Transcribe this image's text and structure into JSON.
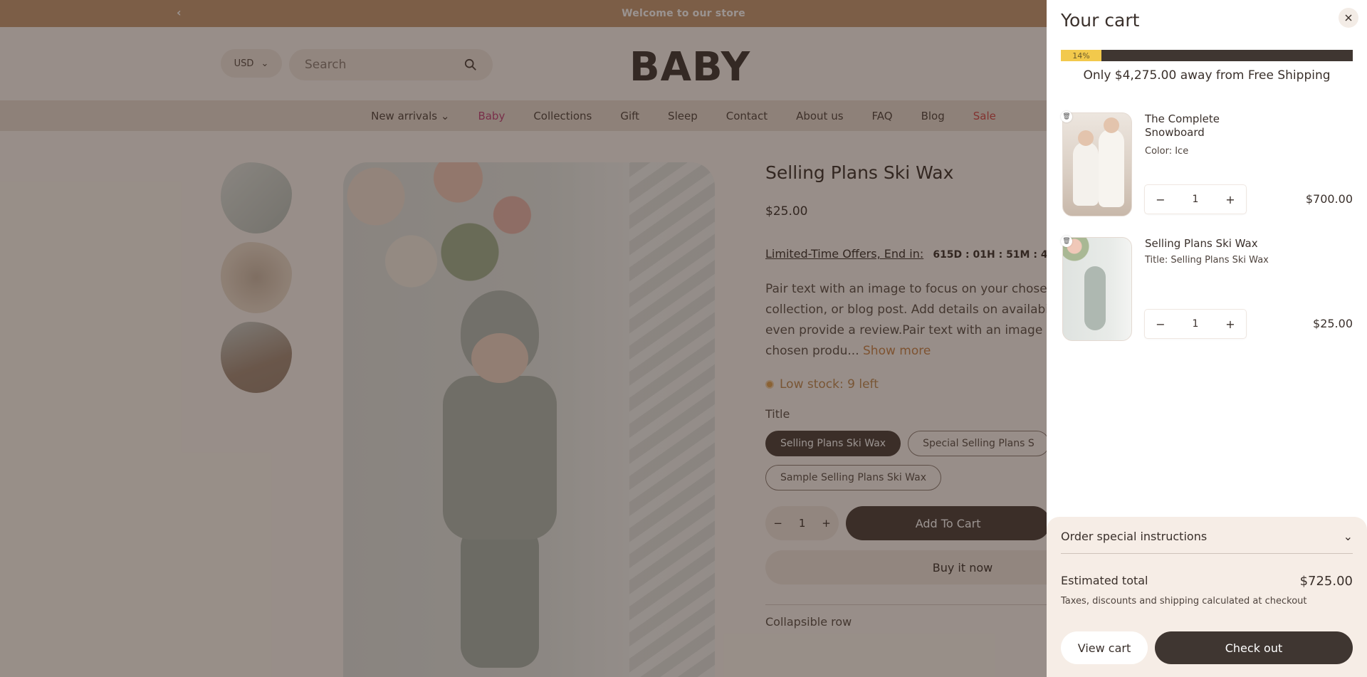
{
  "announcement": {
    "text": "Welcome to our store",
    "prev_icon": "chevron-left-icon"
  },
  "header": {
    "currency": "USD",
    "search_placeholder": "Search",
    "logo": "BABY"
  },
  "nav": {
    "items": [
      "New arrivals",
      "Baby",
      "Collections",
      "Gift",
      "Sleep",
      "Contact",
      "About us",
      "FAQ",
      "Blog",
      "Sale"
    ]
  },
  "product": {
    "title": "Selling Plans Ski Wax",
    "price": "$25.00",
    "offer_label": "Limited-Time Offers, End in:",
    "countdown": "615D : 01H : 51M : 4",
    "description_lines": [
      "Pair text with an image to focus on your chosen",
      "collection, or blog post. Add details on availabi",
      "even provide a review.Pair text with an image t",
      "chosen produ..."
    ],
    "show_more": "Show more",
    "stock": "Low stock: 9 left",
    "option_label": "Title",
    "options": [
      "Selling Plans Ski Wax",
      "Special Selling Plans S",
      "Sample Selling Plans Ski Wax"
    ],
    "selected_option": "Selling Plans Ski Wax",
    "qty": "1",
    "add_to_cart": "Add To Cart",
    "buy_now": "Buy it now",
    "collapsible": "Collapsible row"
  },
  "cart": {
    "title": "Your cart",
    "close_icon": "close-icon",
    "progress_percent": 14,
    "progress_label": "14%",
    "shipping_message": "Only $4,275.00 away from Free Shipping",
    "items": [
      {
        "name": "The Complete Snowboard",
        "option": "Color: Ice",
        "qty": "1",
        "price": "$700.00"
      },
      {
        "name": "Selling Plans Ski Wax",
        "option": "Title: Selling Plans Ski Wax",
        "qty": "1",
        "price": "$25.00"
      }
    ],
    "instructions_label": "Order special instructions",
    "estimated_label": "Estimated total",
    "estimated_value": "$725.00",
    "taxes_note": "Taxes, discounts and shipping calculated at checkout",
    "view_cart": "View cart",
    "checkout": "Check out"
  },
  "colors": {
    "announcement_bg": "#c69a74",
    "accent_dark": "#3f3631",
    "progress_fill": "#f2c94c",
    "sale": "#d24545"
  }
}
